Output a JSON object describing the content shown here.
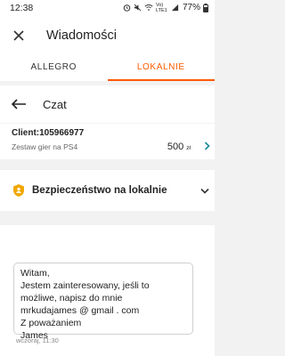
{
  "status": {
    "time": "12:38",
    "signal_text": "Vo) LTE1",
    "battery": "77%"
  },
  "header": {
    "title": "Wiadomości"
  },
  "tabs": [
    {
      "label": "ALLEGRO",
      "active": false
    },
    {
      "label": "LOKALNIE",
      "active": true
    }
  ],
  "chat": {
    "title": "Czat"
  },
  "offer": {
    "client": "Client:105966977",
    "item": "Zestaw gier na PS4",
    "price": "500",
    "currency": "zł"
  },
  "security": {
    "label": "Bezpieczeństwo na lokalnie"
  },
  "message": {
    "lines": [
      "Witam,",
      "Jestem zainteresowany, jeśli to",
      "możliwe, napisz do mnie",
      "mrkudajames @ gmail . com",
      "Z poważaniem",
      "James"
    ],
    "timestamp": "wczoraj, 11:30"
  },
  "colors": {
    "accent": "#ff5a00",
    "security_icon": "#f0a800",
    "link_chevron": "#1a8a9a"
  }
}
